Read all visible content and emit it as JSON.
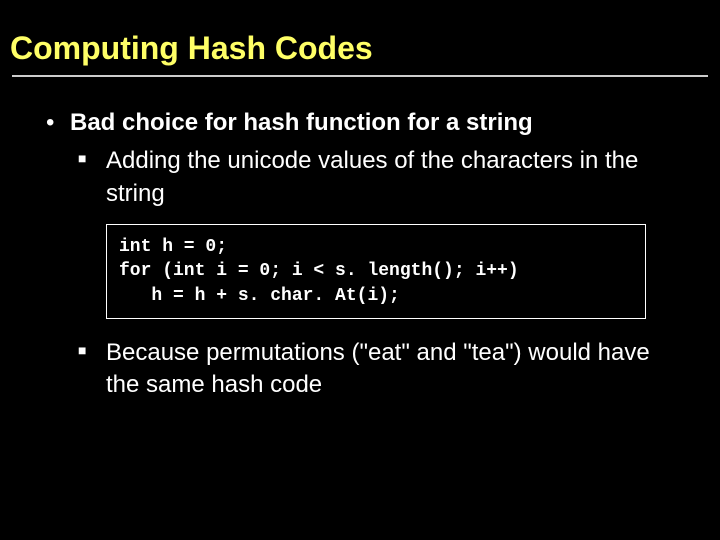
{
  "slide": {
    "title": "Computing Hash Codes",
    "bullet1": "Bad choice for hash function for a string",
    "sub1": "Adding the unicode values of the characters in the string",
    "code": "int h = 0;\nfor (int i = 0; i < s. length(); i++)\n   h = h + s. char. At(i);",
    "sub2": "Because permutations (\"eat\" and \"tea\") would have the same hash code"
  }
}
